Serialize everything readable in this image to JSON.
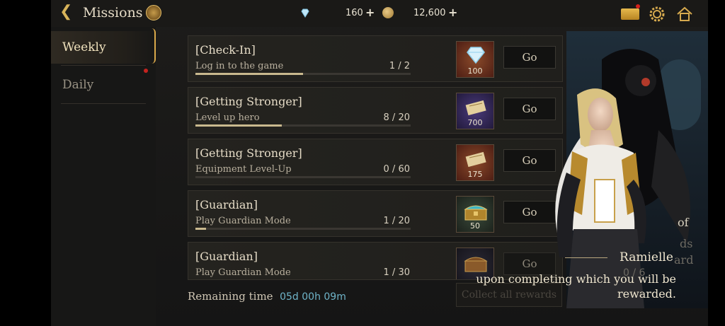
{
  "header": {
    "title": "Missions",
    "gems": "160",
    "gold": "12,600"
  },
  "sidebar": {
    "items": [
      {
        "label": "Weekly",
        "active": true
      },
      {
        "label": "Daily",
        "active": false,
        "has_notification": true
      }
    ]
  },
  "missions": [
    {
      "title": "[Check-In]",
      "desc": "Log in to the game",
      "progress_text": "1 / 2",
      "progress": 0.5,
      "reward_icon": "diamond-icon",
      "reward_qty": "100",
      "button": "Go"
    },
    {
      "title": "[Getting Stronger]",
      "desc": "Level up hero",
      "progress_text": "8 / 20",
      "progress": 0.4,
      "reward_icon": "scroll-icon",
      "reward_qty": "700",
      "button": "Go"
    },
    {
      "title": "[Getting Stronger]",
      "desc": "Equipment Level-Up",
      "progress_text": "0 / 60",
      "progress": 0.0,
      "reward_icon": "scroll-icon",
      "reward_qty": "175",
      "button": "Go"
    },
    {
      "title": "[Guardian]",
      "desc": "Play Guardian Mode",
      "progress_text": "1 / 20",
      "progress": 0.05,
      "reward_icon": "treasure-chest-icon",
      "reward_qty": "50",
      "button": "Go"
    },
    {
      "title": "[Guardian]",
      "desc": "Play Guardian Mode",
      "progress_text": "1 / 30",
      "progress": 0.033,
      "reward_icon": "wooden-chest-icon",
      "reward_qty": "",
      "button": "Go"
    }
  ],
  "footer": {
    "remaining_label": "Remaining time",
    "remaining_value": "05d 00h 09m",
    "collect_all": "Collect all rewards"
  },
  "character": {
    "name": "Ramielle",
    "dialog": "upon completing which you will be rewarded.",
    "faint_text_1": "of",
    "faint_text_2": "ds",
    "faint_text_3": "ard",
    "faint_text_4": "0 / 6"
  },
  "colors": {
    "accent_gold": "#d9a84a",
    "time_blue": "#6fb4c9",
    "notification_red": "#c5231f"
  }
}
